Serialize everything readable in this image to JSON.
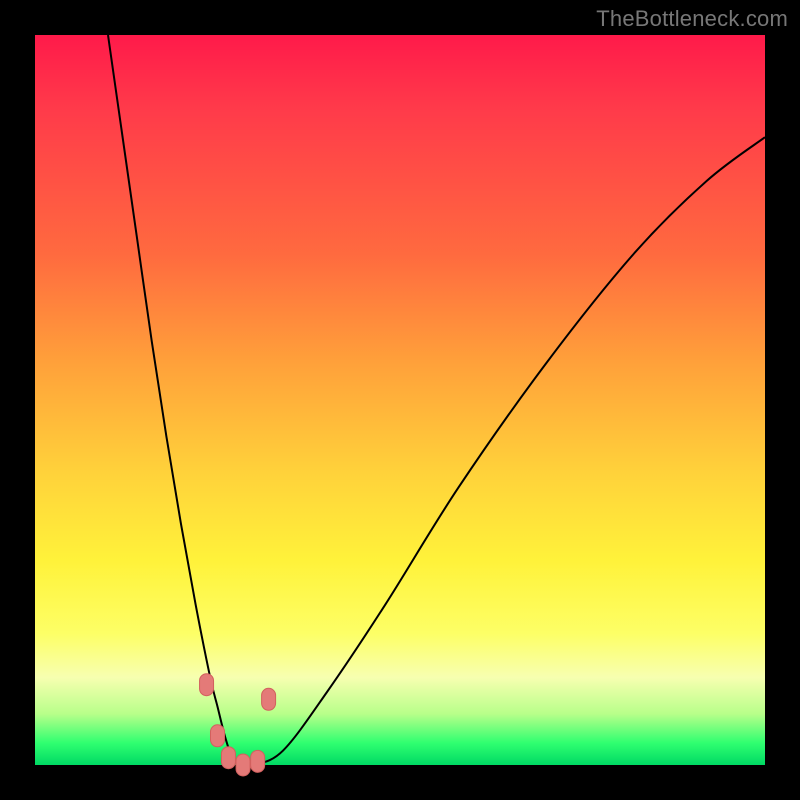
{
  "watermark": "TheBottleneck.com",
  "chart_data": {
    "type": "line",
    "title": "",
    "xlabel": "",
    "ylabel": "",
    "xlim": [
      0,
      100
    ],
    "ylim": [
      0,
      100
    ],
    "grid": false,
    "series": [
      {
        "name": "curve",
        "x": [
          10,
          12,
          14,
          16,
          18,
          20,
          22,
          24,
          25,
          26,
          27,
          28,
          30,
          34,
          40,
          48,
          58,
          70,
          82,
          92,
          100
        ],
        "y": [
          100,
          86,
          72,
          58,
          45,
          33,
          22,
          12,
          8,
          4,
          1,
          0,
          0,
          2,
          10,
          22,
          38,
          55,
          70,
          80,
          86
        ]
      }
    ],
    "markers": {
      "name": "highlighted-points",
      "x": [
        23.5,
        25.0,
        26.5,
        28.5,
        30.5,
        32.0
      ],
      "y": [
        11,
        4,
        1,
        0,
        0.5,
        9
      ]
    },
    "background_gradient": {
      "stops": [
        {
          "pos": 0.0,
          "color": "#ff1a4a"
        },
        {
          "pos": 0.45,
          "color": "#ffa13a"
        },
        {
          "pos": 0.72,
          "color": "#fff23a"
        },
        {
          "pos": 0.93,
          "color": "#b8ff8a"
        },
        {
          "pos": 1.0,
          "color": "#00d964"
        }
      ]
    }
  }
}
